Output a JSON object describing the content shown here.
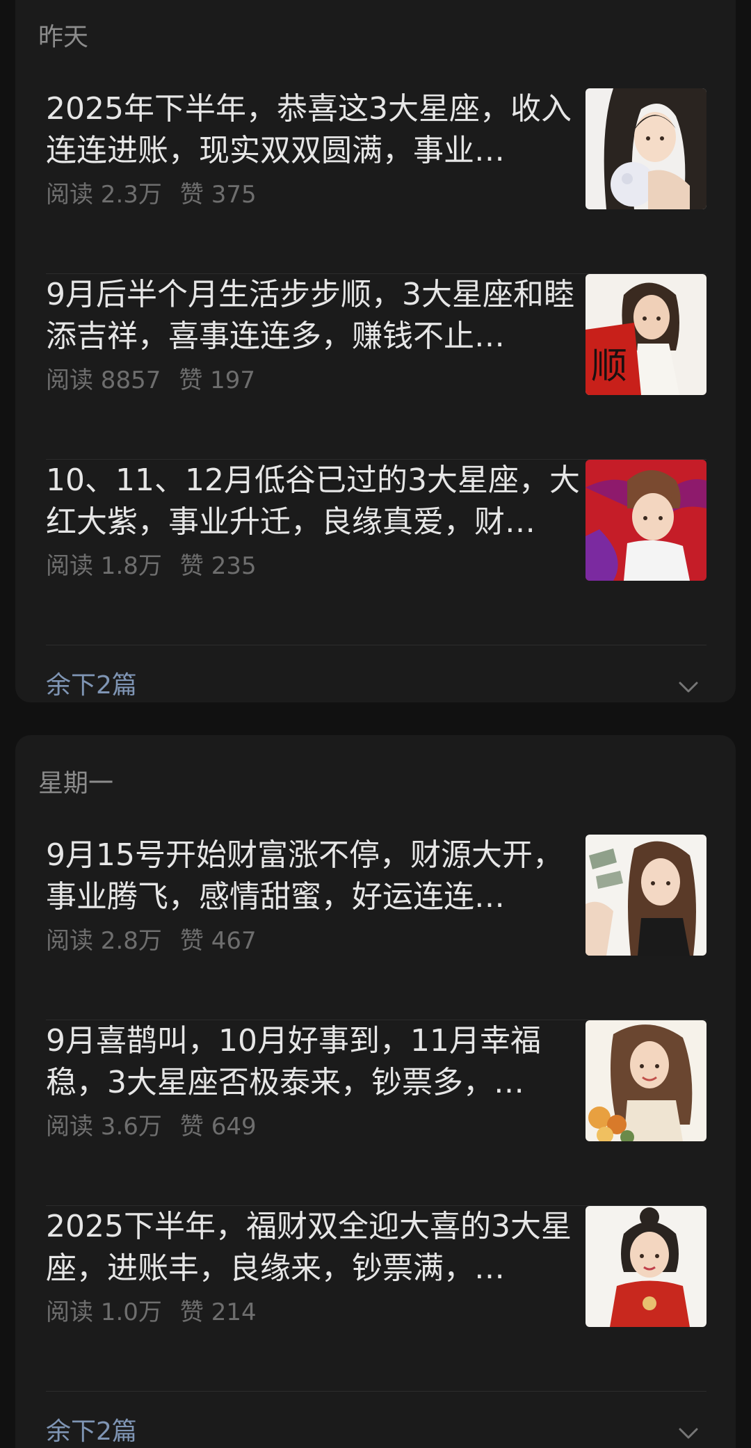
{
  "sections": [
    {
      "date": "昨天",
      "articles": [
        {
          "title": "2025年下半年，恭喜这3大星座，收入连连进账，现实双双圆满，事业…",
          "reads": "阅读 2.3万",
          "likes": "赞 375",
          "thumb_icon": "girl-holding-moon-illustration"
        },
        {
          "title": "9月后半个月生活步步顺，3大星座和睦添吉祥，喜事连连多，赚钱不止…",
          "reads": "阅读 8857",
          "likes": "赞 197",
          "thumb_icon": "girl-with-red-scroll-illustration",
          "thumb_glyph": "顺"
        },
        {
          "title": "10、11、12月低谷已过的3大星座，大红大紫，事业升迁，良缘真爱，财…",
          "reads": "阅读 1.8万",
          "likes": "赞 235",
          "thumb_icon": "boy-with-ribbon-illustration"
        }
      ],
      "more_label": "余下2篇"
    },
    {
      "date": "星期一",
      "articles": [
        {
          "title": "9月15号开始财富涨不停，财源大开，事业腾飞，感情甜蜜，好运连连…",
          "reads": "阅读 2.8万",
          "likes": "赞 467",
          "thumb_icon": "girl-holding-money-illustration"
        },
        {
          "title": "9月喜鹊叫，10月好事到，11月幸福稳，3大星座否极泰来，钞票多，…",
          "reads": "阅读 3.6万",
          "likes": "赞 649",
          "thumb_icon": "girl-with-flowers-illustration"
        },
        {
          "title": "2025下半年，福财双全迎大喜的3大星座，进账丰，良缘来，钞票满，…",
          "reads": "阅读 1.0万",
          "likes": "赞 214",
          "thumb_icon": "girl-in-red-qipao-illustration"
        }
      ],
      "more_label": "余下2篇"
    }
  ],
  "colors": {
    "background": "#111111",
    "card": "#1b1b1b",
    "title_text": "#e6e6e6",
    "meta_text": "#6e6e6e",
    "section_date": "#8c8c8c",
    "more_link": "#7f95b4"
  }
}
